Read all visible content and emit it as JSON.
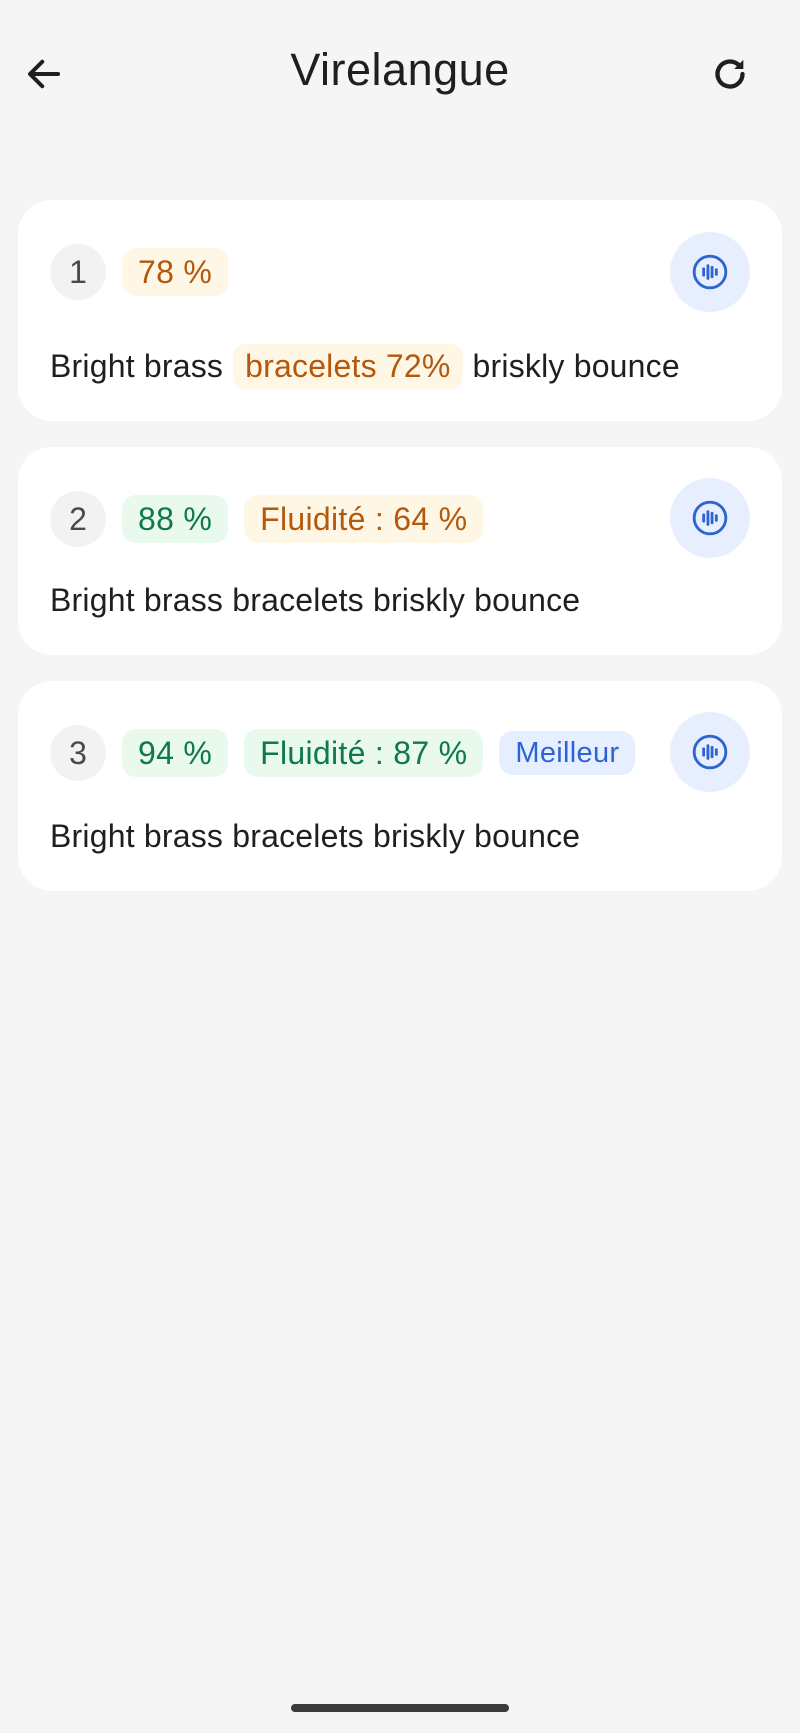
{
  "header": {
    "title": "Virelangue",
    "back_icon": "arrow-left-icon",
    "refresh_icon": "refresh-icon"
  },
  "attempts": [
    {
      "index": "1",
      "score": "78 %",
      "sentence_before": "Bright brass",
      "highlight_word": "bracelets 72%",
      "sentence_after": "briskly bounce"
    },
    {
      "index": "2",
      "score": "88 %",
      "fluency": "Fluidité : 64 %",
      "sentence": "Bright brass bracelets briskly bounce"
    },
    {
      "index": "3",
      "score": "94 %",
      "fluency": "Fluidité : 87 %",
      "best_label": "Meilleur",
      "sentence": "Bright brass bracelets briskly bounce"
    }
  ],
  "colors": {
    "warn_text": "#b4580b",
    "warn_bg": "#fff7e6",
    "good_text": "#10794a",
    "good_bg": "#e9f9ee",
    "accent": "#2e63d3",
    "accent_bg": "#e7efff"
  }
}
